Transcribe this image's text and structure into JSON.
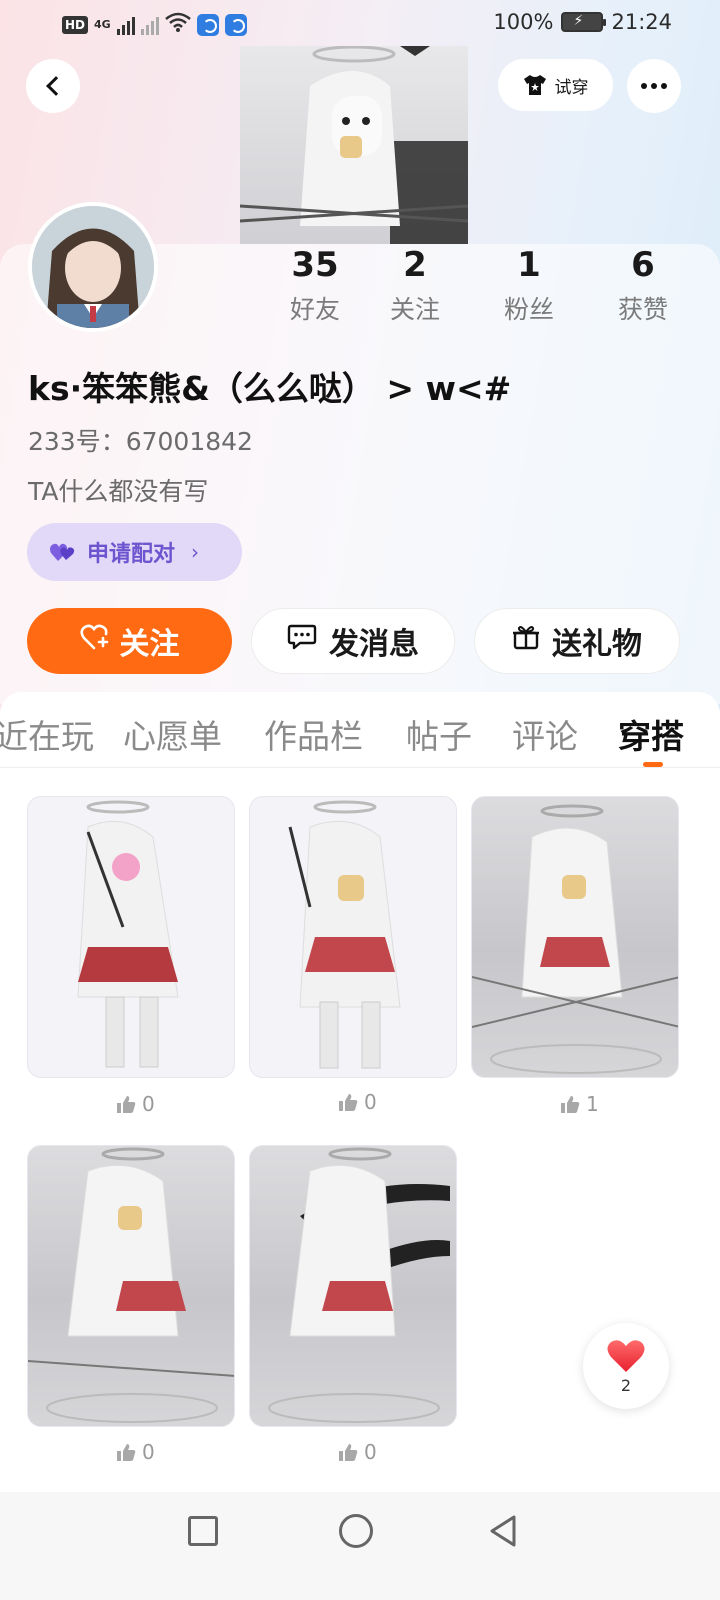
{
  "status_bar": {
    "hd": "HD",
    "network": "4G",
    "battery_percent": "100%",
    "time": "21:24"
  },
  "header": {
    "tryon_label": "试穿"
  },
  "profile": {
    "stats": [
      {
        "value": "35",
        "label": "好友"
      },
      {
        "value": "2",
        "label": "关注"
      },
      {
        "value": "1",
        "label": "粉丝"
      },
      {
        "value": "6",
        "label": "获赞"
      }
    ],
    "username": "ks·笨笨熊&（么么哒） > w<#",
    "user_id": "233号：67001842",
    "bio": "TA什么都没有写",
    "pair_label": "申请配对"
  },
  "actions": {
    "follow": "关注",
    "message": "发消息",
    "gift": "送礼物"
  },
  "tabs": [
    {
      "label": "最近在玩",
      "active": false
    },
    {
      "label": "心愿单",
      "active": false
    },
    {
      "label": "作品栏",
      "active": false
    },
    {
      "label": "帖子",
      "active": false
    },
    {
      "label": "评论",
      "active": false
    },
    {
      "label": "穿搭",
      "active": true
    }
  ],
  "outfits": [
    {
      "likes": "0"
    },
    {
      "likes": "0"
    },
    {
      "likes": "1"
    },
    {
      "likes": "0"
    },
    {
      "likes": "0"
    }
  ],
  "float_like": {
    "count": "2"
  },
  "colors": {
    "accent": "#ff6a13",
    "pair_bg": "#e1d9f7",
    "pair_text": "#6d55cf"
  }
}
